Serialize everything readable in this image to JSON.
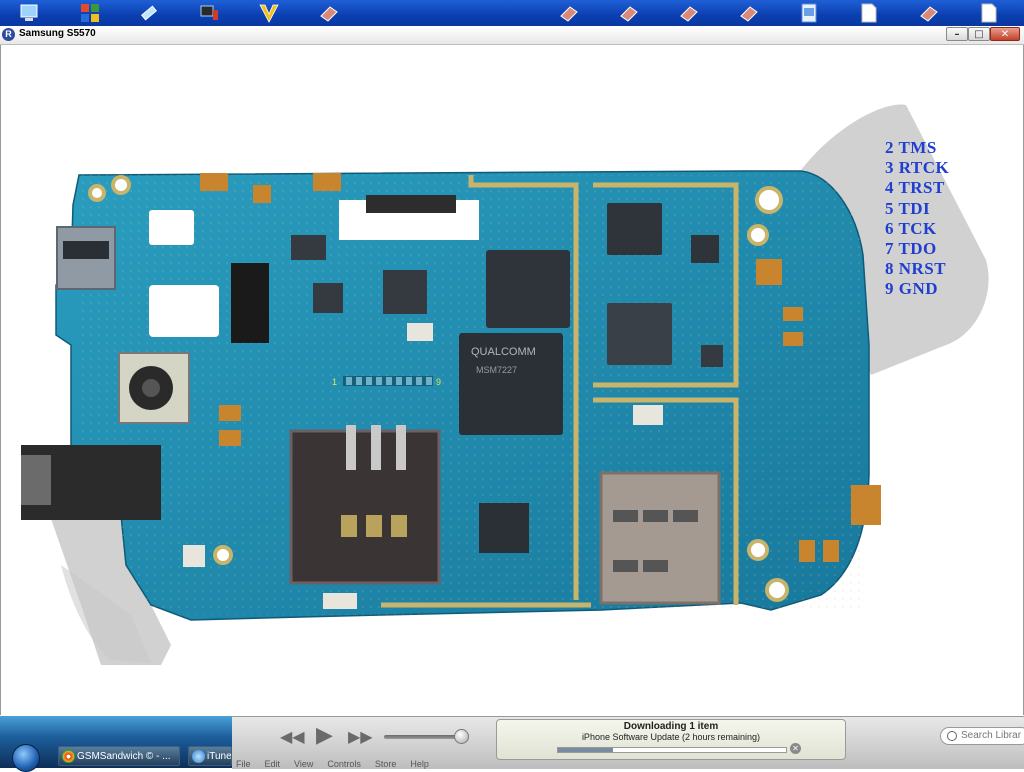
{
  "window": {
    "title": "Samsung S5570",
    "app_logo": "R",
    "controls": {
      "minimize": "–",
      "maximize": "□",
      "close": "✕"
    }
  },
  "quicklaunch": [
    {
      "icon": "computer-icon"
    },
    {
      "icon": "office-icon"
    },
    {
      "icon": "tool-icon"
    },
    {
      "icon": "network-icon"
    },
    {
      "icon": "v-icon"
    },
    {
      "icon": "eraser-icon"
    },
    {
      "icon": "eraser-icon"
    },
    {
      "icon": "eraser-icon"
    },
    {
      "icon": "eraser-icon"
    },
    {
      "icon": "eraser-icon"
    },
    {
      "icon": "document-icon"
    },
    {
      "icon": "page-icon"
    },
    {
      "icon": "eraser-icon"
    },
    {
      "icon": "page-icon"
    }
  ],
  "diagram": {
    "pin_start": "1",
    "pin_end": "9",
    "pins": [
      "2 TMS",
      "3 RTCK",
      "4 TRST",
      "5 TDI",
      "6 TCK",
      "7 TDO",
      "8 NRST",
      "9 GND"
    ],
    "chip_brand": "QUALCOMM",
    "chip_model": "MSM7227",
    "colors": {
      "board": "#1d8fb5",
      "pins_text": "#1f3fd0",
      "watermark": "#c9c9c9"
    }
  },
  "taskbar": {
    "items": [
      {
        "label": "GSMSandwich © - ..."
      },
      {
        "label": "iTune"
      }
    ]
  },
  "itunes": {
    "download_title": "Downloading 1 item",
    "download_detail": "iPhone Software Update (2 hours remaining)",
    "progress": 0.24,
    "search_placeholder": "Search Librar",
    "menu": [
      "File",
      "Edit",
      "View",
      "Controls",
      "Store",
      "Help"
    ]
  }
}
